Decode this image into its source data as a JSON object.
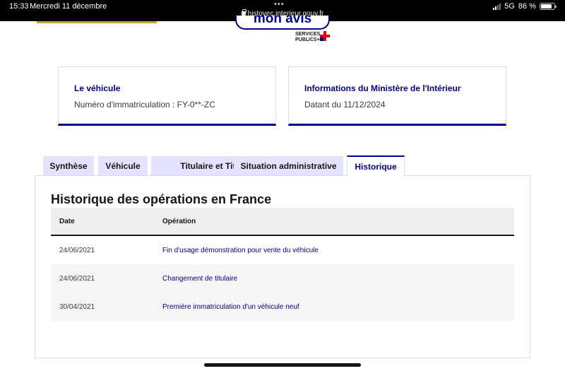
{
  "status_bar": {
    "time": "15:33",
    "date": "Mercredi 11 décembre",
    "url": "histovec.interieur.gouv.fr",
    "network": "5G",
    "battery": "86 %"
  },
  "header": {
    "monavis_label": "mon avis",
    "services_line1": "SERVICES",
    "services_line2": "PUBLICS+"
  },
  "cards": {
    "vehicle": {
      "title": "Le véhicule",
      "text": "Numéro d'immatriculation : FY-0**-ZC"
    },
    "ministry": {
      "title": "Informations du Ministère de l'Intérieur",
      "text": "Datant du 11/12/2024"
    }
  },
  "tabs": [
    {
      "label": "Synthèse",
      "active": false
    },
    {
      "label": "Véhicule",
      "active": false
    },
    {
      "label": "Titulaire et Titre",
      "active": false
    },
    {
      "label": "Situation administrative",
      "active": false
    },
    {
      "label": "Historique",
      "active": true
    }
  ],
  "history": {
    "title": "Historique des opérations en France",
    "columns": [
      "Date",
      "Opération"
    ],
    "rows": [
      {
        "date": "24/06/2021",
        "operation": "Fin d'usage démonstration pour vente du véhicule"
      },
      {
        "date": "24/06/2021",
        "operation": "Changement de titulaire"
      },
      {
        "date": "30/04/2021",
        "operation": "Première immatriculation d'un véhicule neuf"
      }
    ]
  },
  "colors": {
    "primary_blue": "#000091",
    "tab_background": "#e3e3fd",
    "marianne_red": "#e1000f"
  }
}
